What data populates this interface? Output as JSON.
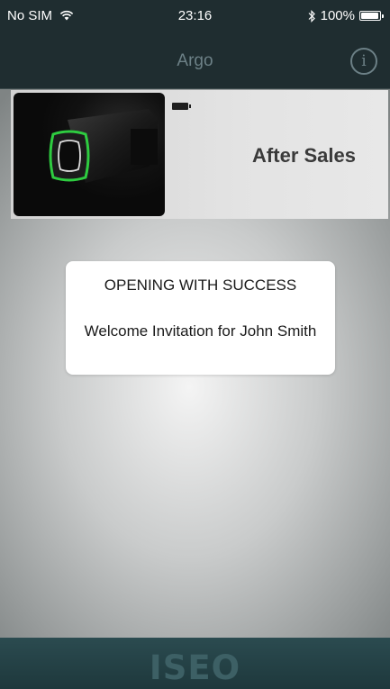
{
  "status_bar": {
    "carrier": "No SIM",
    "time": "23:16",
    "battery": "100%",
    "battery_level": 1.0,
    "icons": [
      "wifi-icon",
      "bluetooth-icon",
      "battery-icon"
    ]
  },
  "nav": {
    "title": "Argo",
    "info_icon": "info-icon",
    "info_glyph": "i"
  },
  "device": {
    "name": "After Sales",
    "image_icon": "smart-lock-cylinder-image",
    "battery_icon": "battery-icon"
  },
  "alert": {
    "title": "OPENING WITH SUCCESS",
    "message": "Welcome Invitation for John Smith"
  },
  "footer": {
    "logo": "ISEO"
  },
  "colors": {
    "bar": "#1f2d30",
    "nav_title": "#6c8086",
    "footer": "#2b4b50",
    "lock_ring": "#2ecc40"
  }
}
